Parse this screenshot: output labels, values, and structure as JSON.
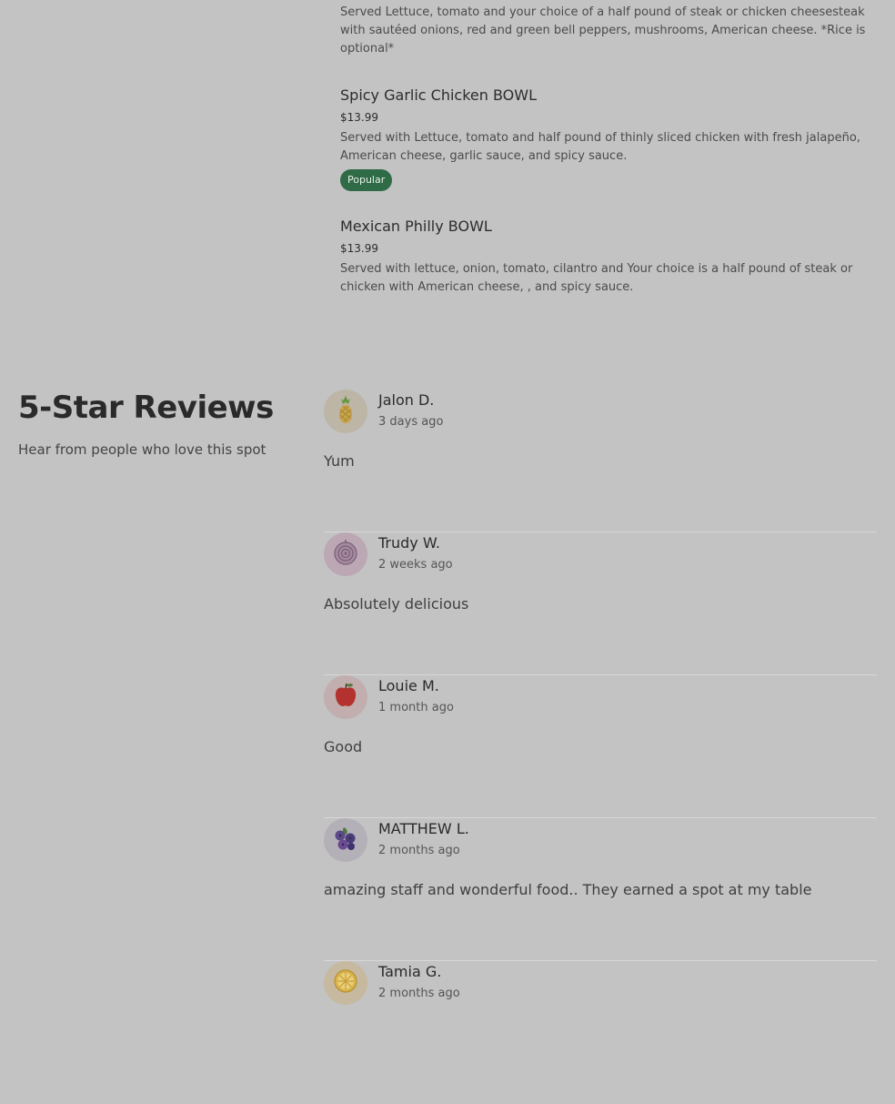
{
  "menu": {
    "items": [
      {
        "name": "",
        "price": "",
        "description": "Served Lettuce, tomato and your choice of a half pound of steak or chicken cheesesteak with sautéed onions, red and green bell peppers, mushrooms, American cheese. *Rice is optional*",
        "badge": ""
      },
      {
        "name": "Spicy Garlic Chicken BOWL",
        "price": "$13.99",
        "description": "Served with Lettuce, tomato and half pound of thinly sliced chicken with fresh jalapeño, American cheese, garlic sauce, and spicy sauce.",
        "badge": "Popular"
      },
      {
        "name": "Mexican Philly BOWL",
        "price": "$13.99",
        "description": "Served with lettuce, onion, tomato, cilantro and Your choice is a half pound of steak or chicken with American cheese, , and spicy sauce.",
        "badge": ""
      }
    ]
  },
  "reviews_section": {
    "title": "5-Star Reviews",
    "subtitle": "Hear from people who love this spot"
  },
  "reviews": [
    {
      "name": "Jalon D.",
      "time": "3 days ago",
      "text": "Yum",
      "avatar_icon": "pineapple-icon"
    },
    {
      "name": "Trudy W.",
      "time": "2 weeks ago",
      "text": "Absolutely delicious",
      "avatar_icon": "onion-icon"
    },
    {
      "name": "Louie M.",
      "time": "1 month ago",
      "text": "Good",
      "avatar_icon": "apple-icon"
    },
    {
      "name": "MATTHEW L.",
      "time": "2 months ago",
      "text": "amazing staff and wonderful food.. They earned a spot at my table",
      "avatar_icon": "blueberry-icon"
    },
    {
      "name": "Tamia G.",
      "time": "2 months ago",
      "text": "",
      "avatar_icon": "lemon-icon"
    }
  ]
}
